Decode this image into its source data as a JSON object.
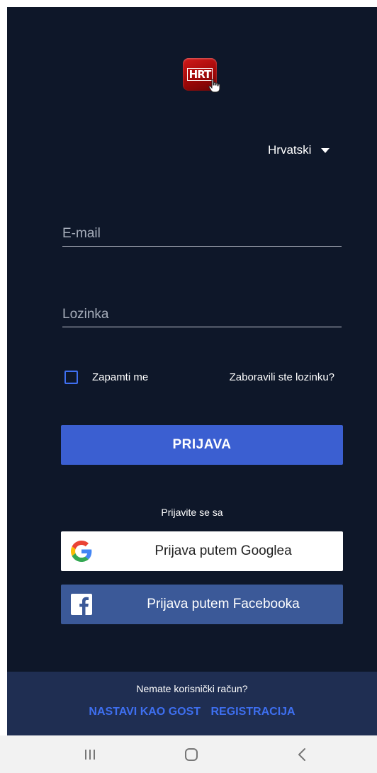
{
  "logo": {
    "text": "HRT",
    "brand_color": "#b30c0c",
    "icon": "hand-pointer-icon"
  },
  "language": {
    "selected": "Hrvatski"
  },
  "form": {
    "email_placeholder": "E-mail",
    "email_value": "",
    "password_placeholder": "Lozinka",
    "password_value": "",
    "remember_label": "Zapamti me",
    "remember_checked": false,
    "forgot_label": "Zaboravili ste lozinku?",
    "login_label": "PRIJAVA"
  },
  "social": {
    "heading": "Prijavite se sa",
    "google_label": "Prijava putem Googlea",
    "facebook_label": "Prijava putem Facebooka"
  },
  "footer": {
    "no_account": "Nemate korisnički račun?",
    "guest_label": "NASTAVI KAO GOST",
    "register_label": "REGISTRACIJA"
  },
  "navbar": {
    "icons": [
      "recent-apps-icon",
      "home-icon",
      "back-icon"
    ]
  },
  "colors": {
    "background": "#0e1729",
    "primary": "#3b5fd1",
    "accent_link": "#3e6ff0",
    "facebook": "#3b5998",
    "footer_bg": "#1f2e52"
  }
}
